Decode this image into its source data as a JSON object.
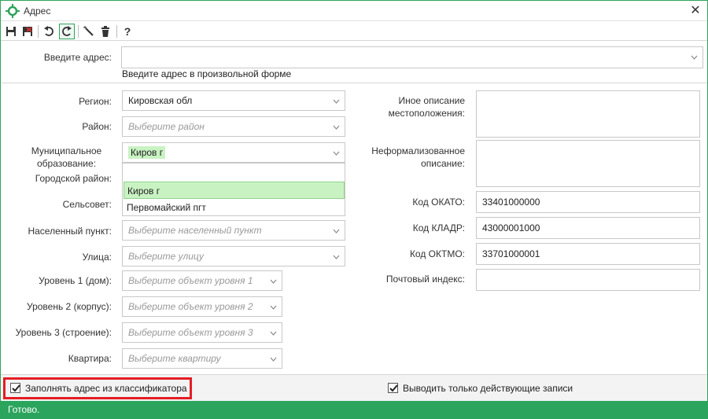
{
  "window": {
    "title": "Адрес",
    "close_glyph": "✕"
  },
  "toolbar": {
    "help_label": "?"
  },
  "address": {
    "label": "Введите адрес:",
    "value": "",
    "hint": "Введите адрес в произвольной форме"
  },
  "left_form": {
    "region": {
      "label": "Регион:",
      "value": "Кировская обл"
    },
    "district": {
      "label": "Район:",
      "placeholder": "Выберите район"
    },
    "municipal": {
      "label_line1": "Муниципальное",
      "label_line2": "образование:",
      "value": "Киров г"
    },
    "city_district": {
      "label": "Городской район:"
    },
    "village_council": {
      "label": "Сельсовет:"
    },
    "settlement": {
      "label": "Населенный пункт:",
      "placeholder": "Выберите населенный пункт"
    },
    "street": {
      "label": "Улица:",
      "placeholder": "Выберите улицу"
    },
    "level1": {
      "label": "Уровень 1 (дом):",
      "placeholder": "Выберите объект уровня 1"
    },
    "level2": {
      "label": "Уровень 2 (корпус):",
      "placeholder": "Выберите объект уровня 2"
    },
    "level3": {
      "label": "Уровень 3 (строение):",
      "placeholder": "Выберите объект уровня 3"
    },
    "apartment": {
      "label": "Квартира:",
      "placeholder": "Выберите квартиру"
    }
  },
  "dropdown": {
    "search_value": "",
    "options": [
      "Киров г",
      "Первомайский пгт"
    ],
    "selected_index": 0
  },
  "right_form": {
    "other_location": {
      "label_line1": "Иное описание",
      "label_line2": "местоположения:"
    },
    "informal": {
      "label_line1": "Неформализованное",
      "label_line2": "описание:"
    },
    "okato": {
      "label": "Код ОКАТО:",
      "value": "33401000000"
    },
    "kladr": {
      "label": "Код КЛАДР:",
      "value": "43000001000"
    },
    "oktmo": {
      "label": "Код ОКТМО:",
      "value": "33701000001"
    },
    "postal": {
      "label": "Почтовый индекс:",
      "value": ""
    }
  },
  "options": {
    "fill_from_classifier": {
      "label": "Заполнять адрес из классификатора",
      "checked": true
    },
    "active_only": {
      "label": "Выводить только действующие записи",
      "checked": true
    }
  },
  "status": {
    "text": "Готово."
  },
  "colors": {
    "accent": "#2fa35a",
    "status_bar": "#2ba55d",
    "highlight": "#c9f2c3",
    "red_outline": "#e31e24"
  }
}
